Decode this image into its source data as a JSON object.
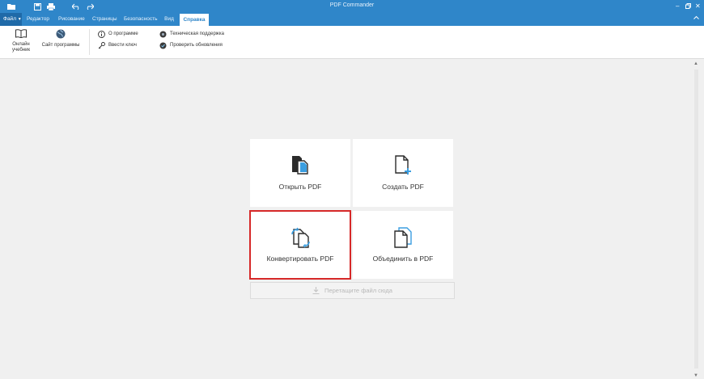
{
  "window": {
    "title": "PDF Commander",
    "controls": [
      "minimize-icon",
      "restore-icon",
      "close-icon"
    ]
  },
  "quick_access": [
    "open-folder-icon",
    "save-icon",
    "print-icon",
    "undo-icon",
    "redo-icon"
  ],
  "tabs": [
    {
      "label": "Файл",
      "kind": "file"
    },
    {
      "label": "Редактор"
    },
    {
      "label": "Рисование"
    },
    {
      "label": "Страницы"
    },
    {
      "label": "Безопасность"
    },
    {
      "label": "Вид"
    },
    {
      "label": "Справка",
      "active": true
    }
  ],
  "ribbon": {
    "online_tutorial": "Онлайн учебник",
    "site": "Сайт программы",
    "about": "О программе",
    "enter_key": "Ввести ключ",
    "support": "Техническая поддержка",
    "updates": "Проверить обновления"
  },
  "cards": {
    "open": "Открыть PDF",
    "create": "Создать PDF",
    "convert": "Конвертировать PDF",
    "merge": "Объединить в PDF"
  },
  "dropzone": "Перетащите файл сюда",
  "colors": {
    "titlebar": "#2f86c9",
    "file_tab": "#1f6aa8",
    "accent": "#2f86c9",
    "highlight": "#d62828",
    "background": "#f0f0f0"
  }
}
